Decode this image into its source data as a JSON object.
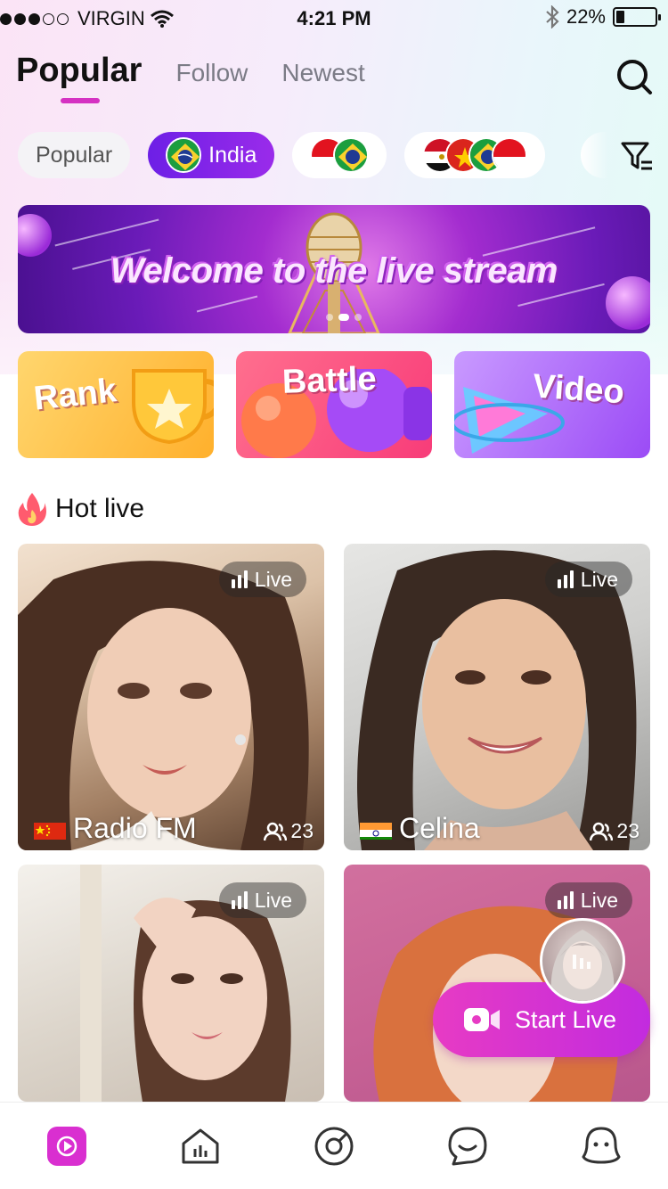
{
  "status_bar": {
    "carrier": "VIRGIN",
    "time": "4:21 PM",
    "battery": "22%",
    "battery_level": 0.22
  },
  "tabs": [
    {
      "label": "Popular",
      "active": true
    },
    {
      "label": "Follow",
      "active": false
    },
    {
      "label": "Newest",
      "active": false
    }
  ],
  "filters": [
    {
      "label": "Popular",
      "active": false
    },
    {
      "label": "India",
      "active": true,
      "flag": "brazil-flag"
    },
    {
      "label": "",
      "flags": [
        "indonesia-flag",
        "brazil-flag"
      ]
    },
    {
      "label": "",
      "flags": [
        "egypt-flag",
        "vietnam-flag",
        "brazil-flag",
        "indonesia-flag"
      ]
    }
  ],
  "banner": {
    "title": "Welcome to the live stream"
  },
  "features": [
    {
      "label": "Rank"
    },
    {
      "label": "Battle"
    },
    {
      "label": "Video"
    }
  ],
  "hot_live": {
    "title": "Hot live",
    "icon": "fire-icon"
  },
  "cards": [
    {
      "name": "Radio FM",
      "flag": "china-flag",
      "viewers": "23",
      "badge": "Live"
    },
    {
      "name": "Celina",
      "flag": "india-flag",
      "viewers": "23",
      "badge": "Live"
    },
    {
      "name": "",
      "badge": "Live"
    },
    {
      "name": "",
      "badge": "Live"
    }
  ],
  "start_live": {
    "label": "Start Live"
  },
  "bottom_nav": [
    {
      "icon": "play-icon",
      "active": true
    },
    {
      "icon": "home-icon",
      "active": false
    },
    {
      "icon": "discover-icon",
      "active": false
    },
    {
      "icon": "chat-icon",
      "active": false
    },
    {
      "icon": "profile-icon",
      "active": false
    }
  ],
  "colors": {
    "accent": "#d531c2",
    "chip_active": "#7a22e8",
    "start_live": "#e73bc4"
  }
}
